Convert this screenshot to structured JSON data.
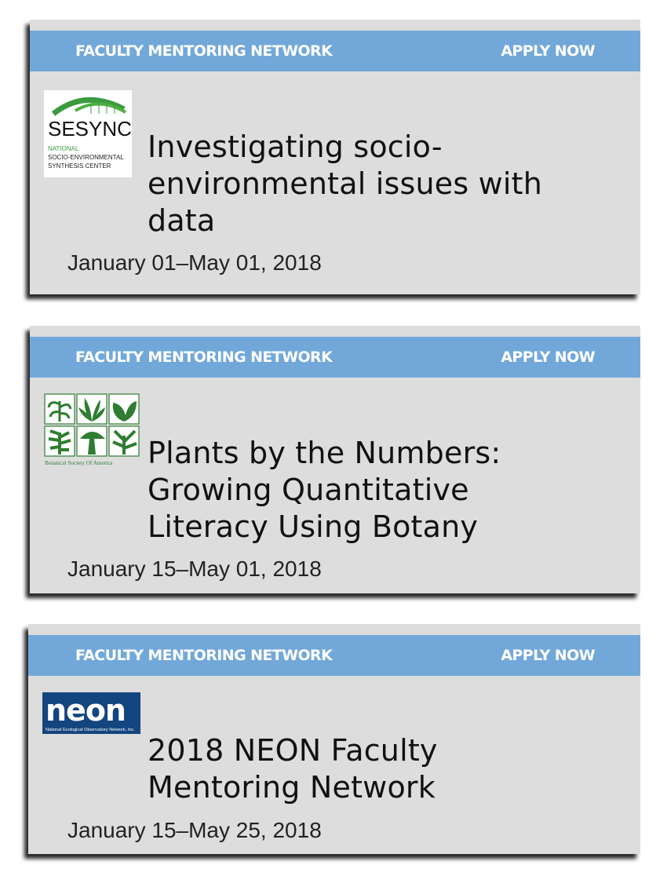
{
  "cards": [
    {
      "banner_label": "FACULTY MENTORING NETWORK",
      "apply_label": "APPLY NOW",
      "logo": {
        "name": "sesync-logo",
        "wordmark": "SESYNC",
        "line1": "NATIONAL",
        "line2": "SOCIO-ENVIRONMENTAL",
        "line3": "SYNTHESIS CENTER"
      },
      "title_lines": [
        "Investigating socio-",
        "environmental issues with",
        "data"
      ],
      "date": "January 01–May 01, 2018"
    },
    {
      "banner_label": "FACULTY MENTORING NETWORK",
      "apply_label": "APPLY NOW",
      "logo": {
        "name": "botanical-society-logo",
        "caption": "Botanical Society Of America"
      },
      "title_lines": [
        "Plants by the Numbers:",
        "Growing Quantitative",
        "Literacy Using Botany"
      ],
      "date": "January 15–May 01, 2018"
    },
    {
      "banner_label": "FACULTY MENTORING NETWORK",
      "apply_label": "APPLY NOW",
      "logo": {
        "name": "neon-logo",
        "wordmark": "neon",
        "caption": "National Ecological Observatory Network, Inc."
      },
      "title_lines": [
        "2018 NEON Faculty",
        "Mentoring Network"
      ],
      "date": "January 15–May 25, 2018"
    }
  ],
  "colors": {
    "banner": "#72a8d9",
    "card": "#dddddd",
    "sesync_green": "#3b9b3f",
    "bsa_green": "#2f7d32",
    "neon_navy": "#13457f"
  }
}
